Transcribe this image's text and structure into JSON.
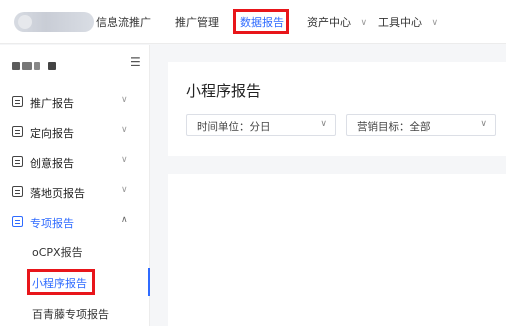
{
  "header": {
    "product_name": "信息流推广",
    "nav": [
      {
        "label": "推广管理",
        "has_dropdown": false,
        "active": false
      },
      {
        "label": "数据报告",
        "has_dropdown": false,
        "active": true
      },
      {
        "label": "资产中心",
        "has_dropdown": true,
        "active": false
      },
      {
        "label": "工具中心",
        "has_dropdown": true,
        "active": false
      }
    ],
    "dropdown_glyph": "∨"
  },
  "sidebar": {
    "menu_toggle_icon": "☰",
    "menu": [
      {
        "label": "推广报告",
        "icon": "chart-report-icon",
        "expanded": false
      },
      {
        "label": "定向报告",
        "icon": "target-report-icon",
        "expanded": false
      },
      {
        "label": "创意报告",
        "icon": "creative-report-icon",
        "expanded": false
      },
      {
        "label": "落地页报告",
        "icon": "landing-page-report-icon",
        "expanded": false
      },
      {
        "label": "专项报告",
        "icon": "special-report-icon",
        "expanded": true
      }
    ],
    "chevron_collapsed": "∨",
    "chevron_expanded": "∧",
    "sub_items": [
      {
        "label": "oCPX报告",
        "active": false
      },
      {
        "label": "小程序报告",
        "active": true
      },
      {
        "label": "百青藤专项报告",
        "active": false
      }
    ]
  },
  "main": {
    "title": "小程序报告",
    "filters": [
      {
        "value": "时间单位：分日"
      },
      {
        "value": "营销目标：全部"
      }
    ],
    "select_chevron": "∨"
  },
  "colors": {
    "accent": "#2f6bff",
    "highlight_box": "#e8151a"
  }
}
